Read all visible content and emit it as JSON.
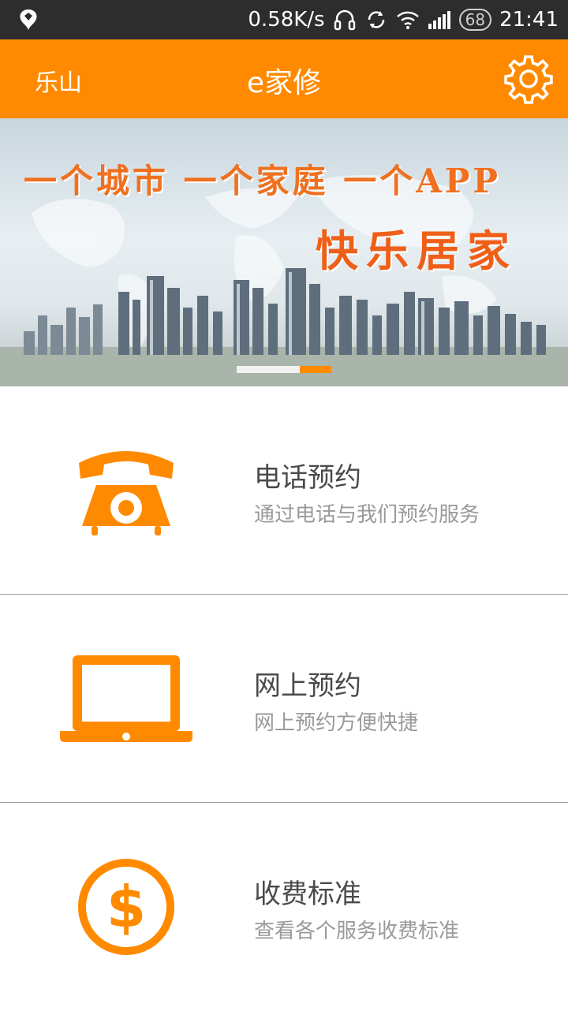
{
  "status_bar": {
    "net_speed": "0.58K/s",
    "battery": "68",
    "time": "21:41",
    "icons": [
      "app-notification-icon",
      "headset-icon",
      "sync-icon",
      "wifi-icon",
      "signal-icon",
      "battery-icon"
    ]
  },
  "app_bar": {
    "city": "乐山",
    "title": "e家修",
    "settings_icon": "gear-icon",
    "color": "#ff8a00"
  },
  "banner": {
    "line1": "一个城市 一个家庭 一个APP",
    "line2": "快乐居家",
    "slide_count": 2,
    "active_slide": 2
  },
  "menu": [
    {
      "title": "电话预约",
      "subtitle": "通过电话与我们预约服务",
      "icon": "telephone-icon"
    },
    {
      "title": "网上预约",
      "subtitle": "网上预约方便快捷",
      "icon": "laptop-icon"
    },
    {
      "title": "收费标准",
      "subtitle": "查看各个服务收费标准",
      "icon": "dollar-icon"
    }
  ],
  "accent_color": "#ff8a00"
}
